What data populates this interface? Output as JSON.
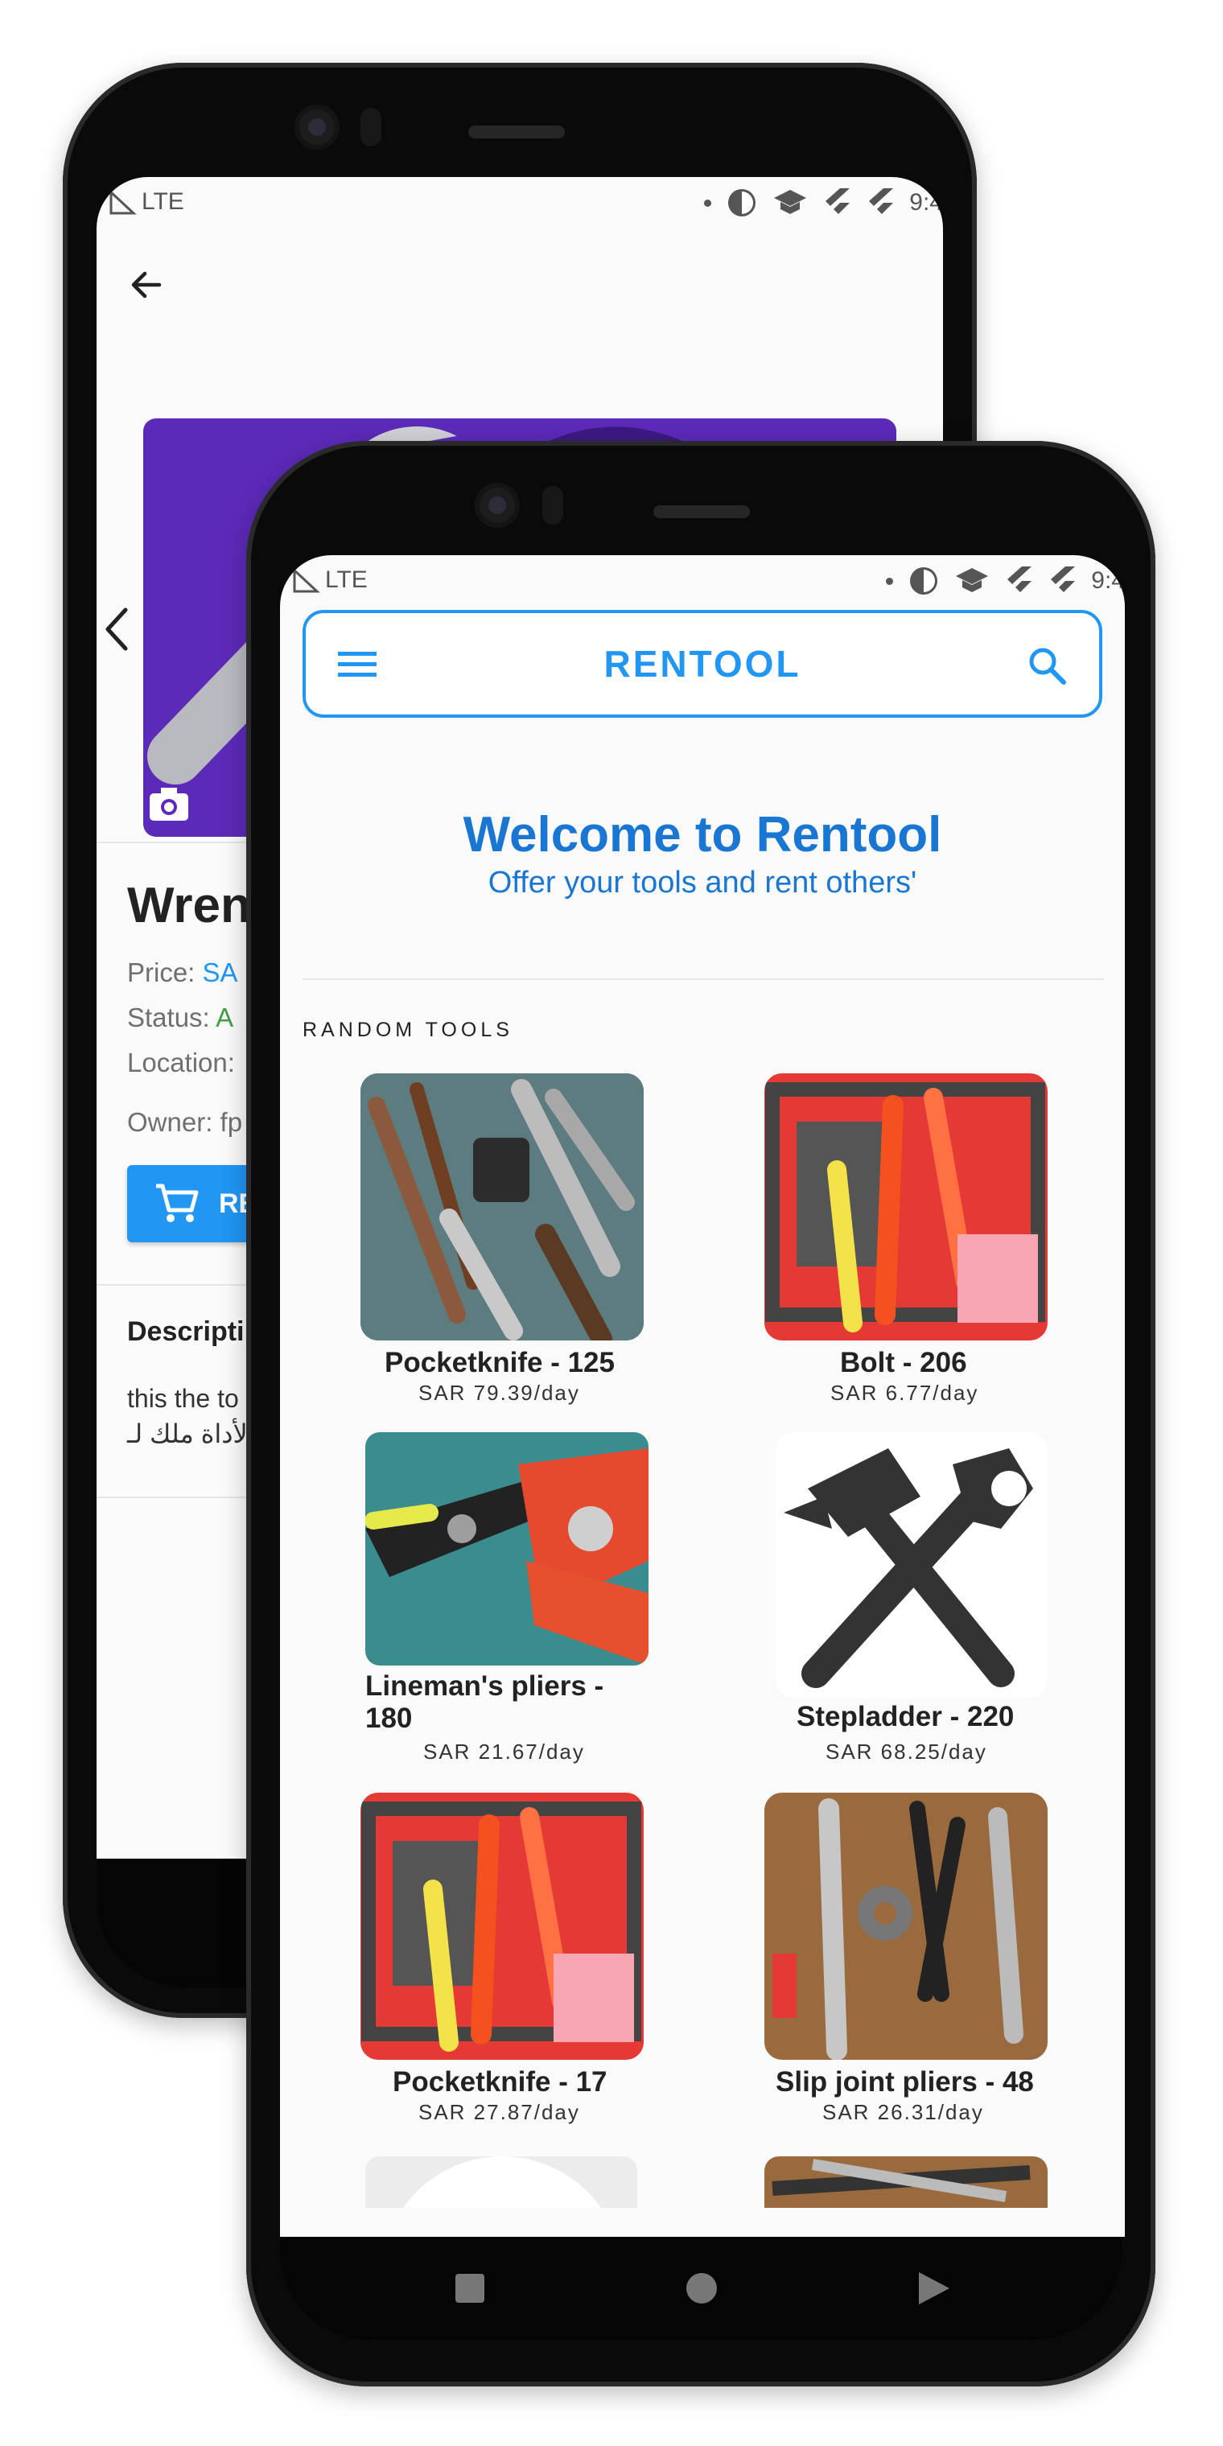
{
  "status_bar": {
    "network": "LTE",
    "time": "9:4"
  },
  "back_screen": {
    "title": "Wren",
    "price_label": "Price:",
    "price_value": "SA",
    "status_label": "Status:",
    "status_value": "A",
    "location_label": "Location:",
    "owner_label": "Owner:",
    "owner_value": "fp",
    "rent_button_label": "RE",
    "description_title": "Descripti",
    "description_line1": "this the to",
    "description_line2": "لأداة ملك لـ",
    "icons": {
      "back": "arrow-left-icon",
      "prev": "chevron-left-icon",
      "camera": "camera-icon",
      "cart": "cart-icon"
    },
    "colors": {
      "header_bg": "#5c2ab8",
      "accent": "#2196f3",
      "available": "#43a047"
    }
  },
  "front_screen": {
    "app_title": "RENTOOL",
    "welcome_title": "Welcome to Rentool",
    "welcome_subtitle": "Offer your tools and rent others'",
    "section_label": "RANDOM TOOLS",
    "tools": [
      {
        "name": "Pocketknife - 125",
        "price": "SAR 79.39/day"
      },
      {
        "name": "Bolt - 206",
        "price": "SAR 6.77/day"
      },
      {
        "name": "Lineman's pliers - 180",
        "price": "SAR 21.67/day"
      },
      {
        "name": "Stepladder - 220",
        "price": "SAR 68.25/day"
      },
      {
        "name": "Pocketknife - 17",
        "price": "SAR 27.87/day"
      },
      {
        "name": "Slip joint pliers - 48",
        "price": "SAR 26.31/day"
      }
    ],
    "icons": {
      "menu": "menu-icon",
      "search": "search-icon",
      "nav_recent": "square-icon",
      "nav_home": "circle-icon",
      "nav_back": "triangle-icon"
    },
    "colors": {
      "primary": "#2196f3",
      "welcome": "#1976d2"
    }
  }
}
